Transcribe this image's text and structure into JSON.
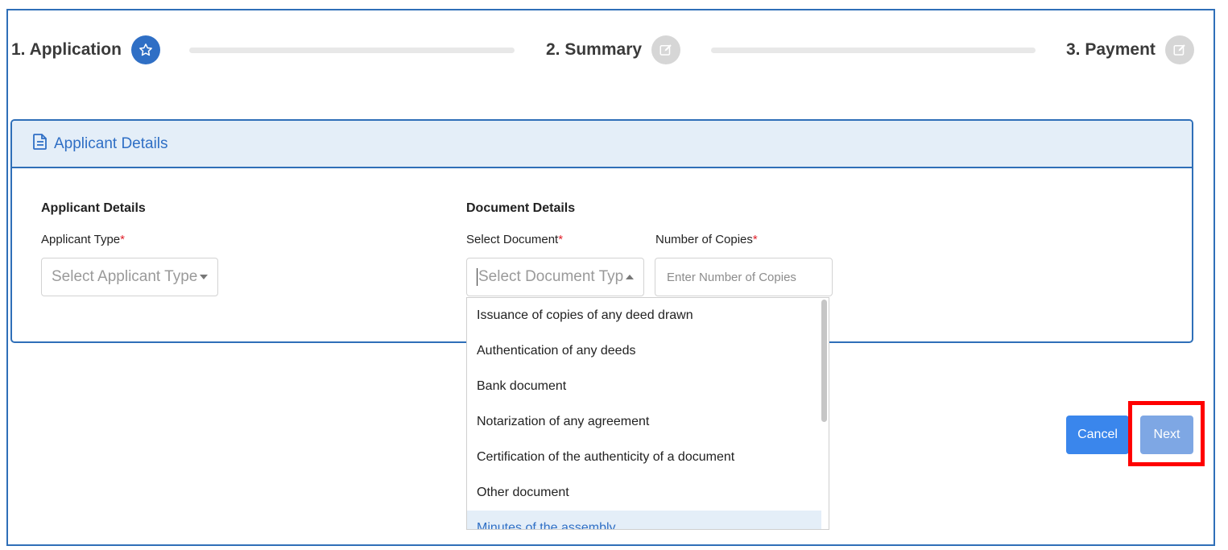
{
  "stepper": {
    "steps": [
      {
        "label": "1. Application",
        "icon": "star-icon",
        "state": "active"
      },
      {
        "label": "2. Summary",
        "icon": "edit-icon",
        "state": "inactive"
      },
      {
        "label": "3. Payment",
        "icon": "edit-icon",
        "state": "inactive"
      }
    ]
  },
  "card": {
    "header_title": "Applicant Details",
    "header_icon": "document-icon"
  },
  "applicant_section": {
    "title": "Applicant Details",
    "type_label": "Applicant Type",
    "required_mark": "*",
    "type_placeholder": "Select Applicant Type"
  },
  "document_section": {
    "title": "Document Details",
    "select_label": "Select Document",
    "required_mark": "*",
    "select_placeholder": "Select Document Type",
    "copies_label": "Number of Copies",
    "copies_placeholder": "Enter Number of Copies",
    "options": [
      "Issuance of copies of any deed drawn",
      "Authentication of any deeds",
      "Bank document",
      "Notarization of any agreement",
      "Certification of the authenticity of a document",
      "Other document",
      "Minutes of the assembly"
    ]
  },
  "actions": {
    "cancel_label": "Cancel",
    "next_label": "Next"
  },
  "colors": {
    "primary": "#2f6fc5",
    "border": "#2f6fb8",
    "header_bg": "#e4eef8",
    "required": "#e0202a",
    "annotation": "#ff0000"
  }
}
